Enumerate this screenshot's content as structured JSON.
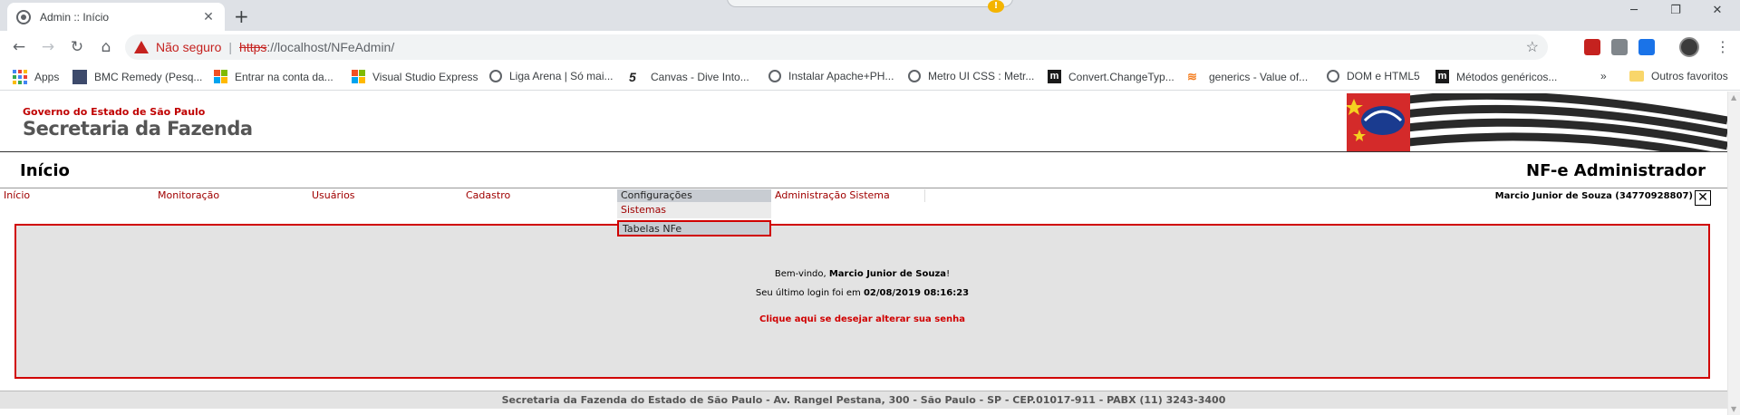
{
  "browser": {
    "tab_title": "Admin :: Início",
    "tab_close": "✕",
    "new_tab": "+",
    "insecure_label": "Não seguro",
    "url_scheme": "https",
    "url_rest": "://localhost/NFeAdmin/",
    "window_controls": [
      "─",
      "❐",
      "✕"
    ]
  },
  "bookmarks": {
    "items": [
      {
        "label": "Apps",
        "icon": "apps-grid-icon"
      },
      {
        "label": "BMC Remedy (Pesq...",
        "icon": "bmc-icon"
      },
      {
        "label": "Entrar na conta da...",
        "icon": "microsoft-icon"
      },
      {
        "label": "Visual Studio Express",
        "icon": "microsoft-icon"
      },
      {
        "label": "Liga Arena | Só mai...",
        "icon": "globe-icon"
      },
      {
        "label": "Canvas - Dive Into...",
        "icon": "canvas-icon"
      },
      {
        "label": "Instalar Apache+PH...",
        "icon": "globe-icon"
      },
      {
        "label": "Metro UI CSS : Metr...",
        "icon": "globe-icon"
      },
      {
        "label": "Convert.ChangeTyp...",
        "icon": "m-icon"
      },
      {
        "label": "generics - Value of...",
        "icon": "stackoverflow-icon"
      },
      {
        "label": "DOM e HTML5",
        "icon": "globe-icon"
      },
      {
        "label": "Métodos genéricos...",
        "icon": "m-icon"
      }
    ],
    "overflow": "»",
    "other_favorites": "Outros favoritos"
  },
  "page": {
    "gov_label": "Governo do Estado de São Paulo",
    "sefaz_label": "Secretaria da Fazenda",
    "section_title": "Início",
    "app_title": "NF-e Administrador",
    "menu": [
      {
        "label": "Início",
        "active": false
      },
      {
        "label": "Monitoração",
        "active": false
      },
      {
        "label": "Usuários",
        "active": false
      },
      {
        "label": "Cadastro",
        "active": false
      },
      {
        "label": "Configurações",
        "active": true
      },
      {
        "label": "Administração Sistema",
        "active": false
      }
    ],
    "submenu": [
      "Sistemas",
      "Tabelas NFe"
    ],
    "user": "Marcio Junior de Souza (34770928807)",
    "logout_symbol": "✕",
    "welcome_prefix": "Bem-vindo, ",
    "welcome_name": "Marcio Junior de Souza",
    "welcome_suffix": "!",
    "last_login_prefix": "Seu último login foi em ",
    "last_login_value": "02/08/2019 08:16:23",
    "change_password": "Clique aqui se desejar alterar sua senha",
    "footer": "Secretaria da Fazenda do Estado de São Paulo - Av. Rangel Pestana, 300 - São Paulo - SP - CEP.01017-911 - PABX (11) 3243-3400"
  },
  "colors": {
    "accent_red": "#d00000",
    "menu_red": "#a00000",
    "content_bg": "#e3e3e3",
    "active_menu_bg": "#c8ccd2"
  }
}
